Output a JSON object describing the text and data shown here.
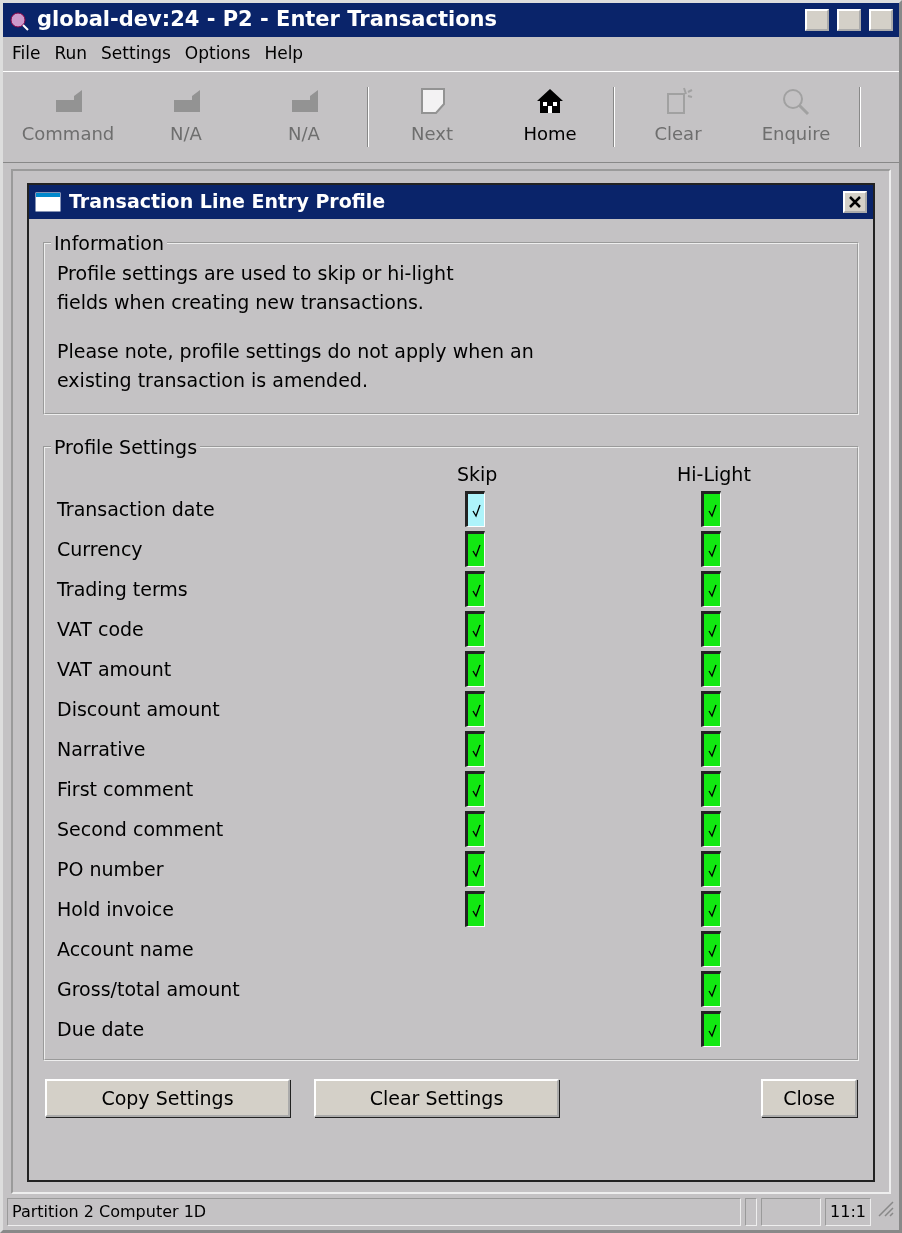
{
  "window": {
    "title": "global-dev:24 - P2 - Enter Transactions"
  },
  "menu": [
    "File",
    "Run",
    "Settings",
    "Options",
    "Help"
  ],
  "toolbar": [
    {
      "label": "Command",
      "kind": "f1",
      "disabled": true
    },
    {
      "label": "N/A",
      "kind": "f2",
      "disabled": true
    },
    {
      "label": "N/A",
      "kind": "f3",
      "disabled": true
    },
    {
      "label": "Next",
      "kind": "next",
      "disabled": true
    },
    {
      "label": "Home",
      "kind": "home",
      "disabled": false
    },
    {
      "label": "Clear",
      "kind": "clear",
      "disabled": true
    },
    {
      "label": "Enquire",
      "kind": "enquire",
      "disabled": true
    }
  ],
  "dialog": {
    "title": "Transaction Line Entry Profile",
    "information": {
      "legend": "Information",
      "paragraphs": [
        "Profile settings are used to skip or hi-light\nfields when creating new transactions.",
        "Please note, profile settings do not apply when an\nexisting transaction is amended."
      ]
    },
    "profile": {
      "legend": "Profile Settings",
      "columns": [
        "Skip",
        "Hi-Light"
      ],
      "rows": [
        {
          "label": "Transaction date",
          "skip": {
            "checked": true,
            "focused": true
          },
          "hilight": {
            "checked": true,
            "focused": false
          }
        },
        {
          "label": "Currency",
          "skip": {
            "checked": true,
            "focused": false
          },
          "hilight": {
            "checked": true,
            "focused": false
          }
        },
        {
          "label": "Trading terms",
          "skip": {
            "checked": true,
            "focused": false
          },
          "hilight": {
            "checked": true,
            "focused": false
          }
        },
        {
          "label": "VAT code",
          "skip": {
            "checked": true,
            "focused": false
          },
          "hilight": {
            "checked": true,
            "focused": false
          }
        },
        {
          "label": "VAT amount",
          "skip": {
            "checked": true,
            "focused": false
          },
          "hilight": {
            "checked": true,
            "focused": false
          }
        },
        {
          "label": "Discount amount",
          "skip": {
            "checked": true,
            "focused": false
          },
          "hilight": {
            "checked": true,
            "focused": false
          }
        },
        {
          "label": "Narrative",
          "skip": {
            "checked": true,
            "focused": false
          },
          "hilight": {
            "checked": true,
            "focused": false
          }
        },
        {
          "label": "First comment",
          "skip": {
            "checked": true,
            "focused": false
          },
          "hilight": {
            "checked": true,
            "focused": false
          }
        },
        {
          "label": "Second comment",
          "skip": {
            "checked": true,
            "focused": false
          },
          "hilight": {
            "checked": true,
            "focused": false
          }
        },
        {
          "label": "PO number",
          "skip": {
            "checked": true,
            "focused": false
          },
          "hilight": {
            "checked": true,
            "focused": false
          }
        },
        {
          "label": "Hold invoice",
          "skip": {
            "checked": true,
            "focused": false
          },
          "hilight": {
            "checked": true,
            "focused": false
          }
        },
        {
          "label": "Account name",
          "hilight": {
            "checked": true,
            "focused": false
          }
        },
        {
          "label": "Gross/total amount",
          "hilight": {
            "checked": true,
            "focused": false
          }
        },
        {
          "label": "Due date",
          "hilight": {
            "checked": true,
            "focused": false
          }
        }
      ]
    },
    "buttons": [
      "Copy Settings",
      "Clear Settings",
      "Close"
    ]
  },
  "status_bar": {
    "text": "Partition 2 Computer 1D",
    "position": "11:1"
  }
}
